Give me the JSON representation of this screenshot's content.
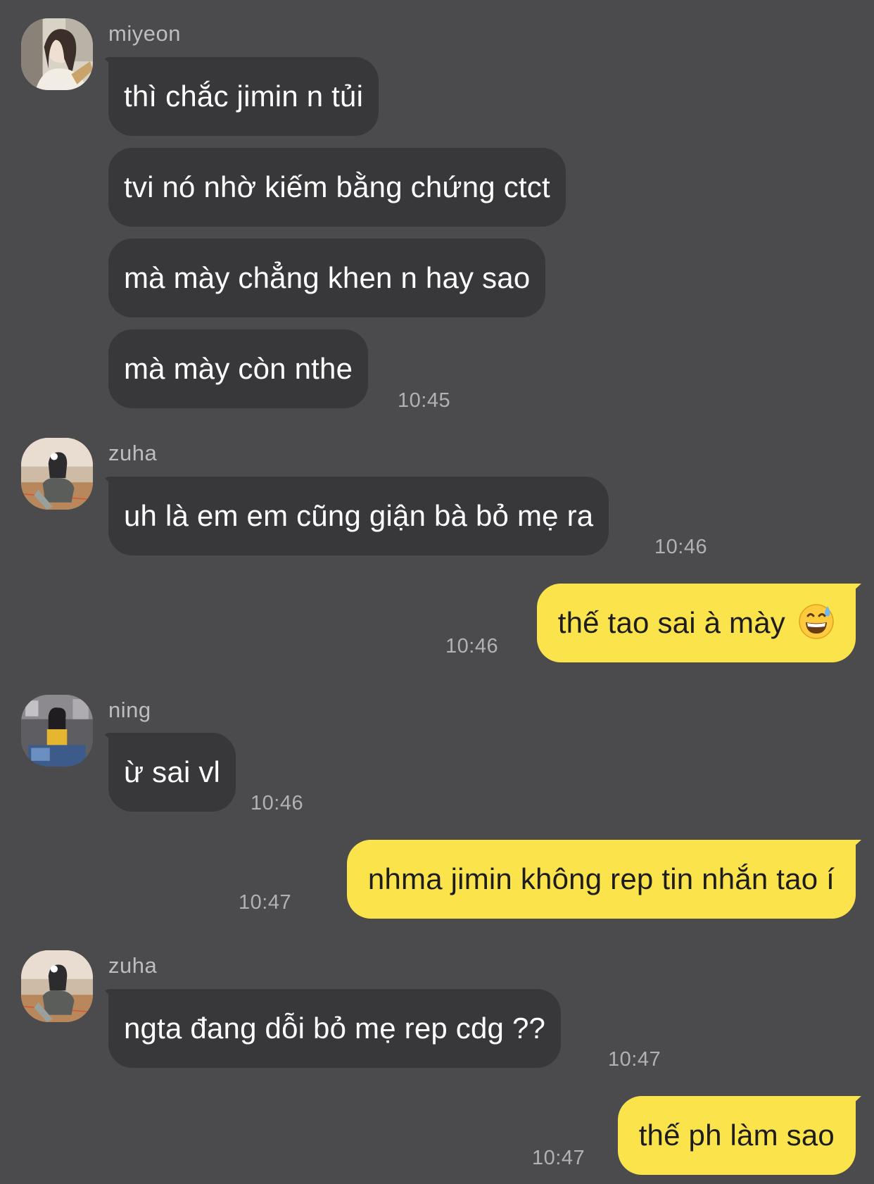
{
  "colors": {
    "background": "#4b4a4c",
    "incoming_bubble": "#38373a",
    "outgoing_bubble": "#fbe44b",
    "incoming_text": "#ffffff",
    "outgoing_text": "#1d1c1e",
    "meta_text": "#b2b1b3"
  },
  "messages": [
    {
      "sender": "miyeon",
      "direction": "incoming",
      "avatar_icon": "profile-photo",
      "lines": [
        "thì chắc jimin n tủi",
        "tvi nó nhờ kiếm bằng chứng ctct",
        "mà mày chẳng khen n hay sao",
        "mà mày còn nthe"
      ],
      "time": "10:45"
    },
    {
      "sender": "zuha",
      "direction": "incoming",
      "avatar_icon": "profile-photo",
      "lines": [
        "uh là em em cũng giận bà bỏ mẹ ra"
      ],
      "time": "10:46"
    },
    {
      "direction": "outgoing",
      "lines": [
        "thế tao sai à mày"
      ],
      "emoji_icon": "grinning-sweat-emoji",
      "time": "10:46"
    },
    {
      "sender": "ning",
      "direction": "incoming",
      "avatar_icon": "profile-photo",
      "lines": [
        "ừ sai vl"
      ],
      "time": "10:46"
    },
    {
      "direction": "outgoing",
      "lines": [
        "nhma jimin không rep tin nhắn tao í"
      ],
      "time": "10:47"
    },
    {
      "sender": "zuha",
      "direction": "incoming",
      "avatar_icon": "profile-photo",
      "lines": [
        "ngta đang dỗi bỏ mẹ rep cdg ??"
      ],
      "time": "10:47"
    },
    {
      "direction": "outgoing",
      "lines": [
        "thế ph làm sao"
      ],
      "time": "10:47"
    }
  ]
}
